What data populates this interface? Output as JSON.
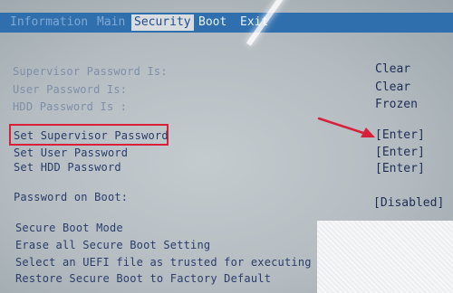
{
  "menubar": {
    "tabs": [
      {
        "label": "Information"
      },
      {
        "label": "Main"
      },
      {
        "label": "Security"
      },
      {
        "label": "Boot"
      },
      {
        "label": "Exit"
      }
    ]
  },
  "security": {
    "status": [
      {
        "label": "Supervisor Password Is:",
        "value": "Clear"
      },
      {
        "label": "User Password Is:",
        "value": "Clear"
      },
      {
        "label": "HDD Password Is :",
        "value": "Frozen"
      }
    ],
    "actions": [
      {
        "label": "Set Supervisor Password",
        "value": "[Enter]"
      },
      {
        "label": "Set User Password",
        "value": "[Enter]"
      },
      {
        "label": "Set HDD Password",
        "value": "[Enter]"
      }
    ],
    "password_on_boot": {
      "label": "Password on Boot:",
      "value": "[Disabled]"
    },
    "secure_boot_lines": [
      "Secure Boot Mode",
      "Erase all Secure Boot Setting",
      "Select an UEFI file as trusted for executing",
      "Restore Secure Boot to Factory Default"
    ]
  },
  "colors": {
    "menubar": "#2f6fae",
    "highlight_box": "#d8203a",
    "arrow": "#d8203a"
  },
  "icons": [
    "red-arrow-icon"
  ]
}
